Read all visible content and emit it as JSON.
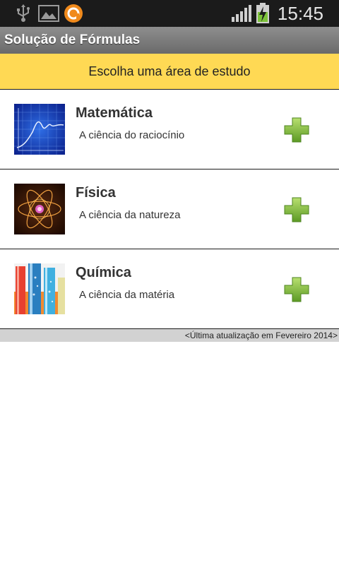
{
  "status_bar": {
    "time": "15:45",
    "icons": [
      "usb-icon",
      "gallery-icon",
      "app-notification-icon",
      "signal-icon",
      "battery-charging-icon"
    ]
  },
  "app": {
    "title": "Solução de Fórmulas"
  },
  "header": {
    "text": "Escolha uma área de estudo"
  },
  "areas": [
    {
      "title": "Matemática",
      "subtitle": "A ciência do raciocínio",
      "icon": "math-graph-thumbnail",
      "action_icon": "plus-icon"
    },
    {
      "title": "Física",
      "subtitle": "A ciência da natureza",
      "icon": "atom-thumbnail",
      "action_icon": "plus-icon"
    },
    {
      "title": "Química",
      "subtitle": "A ciência da matéria",
      "icon": "test-tubes-thumbnail",
      "action_icon": "plus-icon"
    }
  ],
  "footer": {
    "text": "<Última atualização em Fevereiro 2014>"
  },
  "colors": {
    "status_bar": "#1b1b1b",
    "header_accent": "#ffd954",
    "plus_green": "#8cc63f",
    "footer_bg": "#d2d2d2"
  }
}
